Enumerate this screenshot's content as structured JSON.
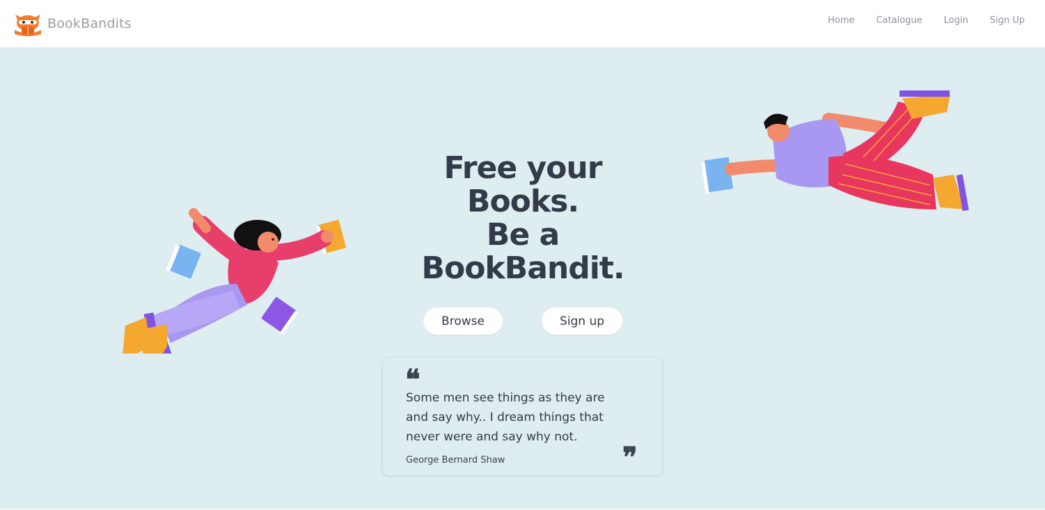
{
  "brand": {
    "name": "BookBandits",
    "logo_icon": "raccoon-bandit-icon",
    "accent": "#f47c2c"
  },
  "nav": {
    "items": [
      {
        "label": "Home"
      },
      {
        "label": "Catalogue"
      },
      {
        "label": "Login"
      },
      {
        "label": "Sign Up"
      }
    ]
  },
  "hero": {
    "background": "#ddedf0",
    "title_lines": [
      "Free your",
      "Books.",
      "Be a",
      "BookBandit."
    ],
    "buttons": {
      "browse": "Browse",
      "signup": "Sign up"
    }
  },
  "quote": {
    "open_mark": "❝",
    "close_mark": "❞",
    "text": "Some men see things as they are and say why.. I dream things that never were and say why not.",
    "author": "George Bernard Shaw"
  },
  "illustrations": {
    "left": "flying-woman-with-books-illustration",
    "right": "flying-man-with-book-illustration"
  }
}
